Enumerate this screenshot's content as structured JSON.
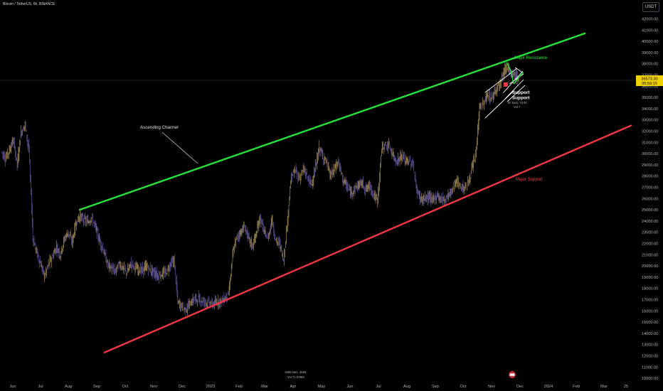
{
  "header": {
    "symbol_title": "Bitcoin / TetherUS, 6h, BINANCE",
    "currency": "USDT"
  },
  "chart_data": {
    "type": "line",
    "title": "Bitcoin / TetherUS, 6h, BINANCE",
    "ylim": [
      9500,
      42800
    ],
    "y_ticks": [
      "42000.00",
      "41000.00",
      "40000.00",
      "39000.00",
      "38000.00",
      "37000.00",
      "36000.00",
      "35000.00",
      "34000.00",
      "33000.00",
      "32000.00",
      "31000.00",
      "30000.00",
      "29000.00",
      "28000.00",
      "27000.00",
      "26000.00",
      "25000.00",
      "24000.00",
      "23000.00",
      "22000.00",
      "21000.00",
      "20000.00",
      "19000.00",
      "18000.00",
      "17000.00",
      "16000.00",
      "15000.00",
      "14000.00",
      "13000.00",
      "12000.00",
      "11000.00",
      "10000.00"
    ],
    "x_ticks": [
      "Jun",
      "Jul",
      "Aug",
      "Sep",
      "Oct",
      "Nov",
      "Dec",
      "2023",
      "Feb",
      "Mar",
      "Apr",
      "May",
      "Jun",
      "Jul",
      "Aug",
      "Sep",
      "Oct",
      "Nov",
      "Dec",
      "2024",
      "Feb",
      "Mar",
      "25"
    ],
    "current_price": "36573.30",
    "countdown": "05:59:15",
    "price_series": {
      "name": "",
      "values": [
        30200,
        29600,
        30300,
        31200,
        29000,
        31900,
        32600,
        30400,
        22500,
        21200,
        20100,
        19100,
        20200,
        20800,
        21700,
        21000,
        22400,
        23000,
        22100,
        23800,
        24500,
        24100,
        23900,
        24300,
        23400,
        22300,
        21400,
        20200,
        19800,
        19500,
        20200,
        19800,
        19400,
        20200,
        19900,
        19700,
        19600,
        20000,
        19600,
        19400,
        19100,
        19300,
        19400,
        20100,
        20500,
        16800,
        16400,
        16100,
        16600,
        17000,
        17100,
        16900,
        16800,
        16700,
        16600,
        16800,
        16900,
        17100,
        17600,
        21000,
        22500,
        23000,
        23500,
        22500,
        21800,
        22800,
        24300,
        23000,
        22400,
        24200,
        22200,
        22000,
        20500,
        24200,
        28000,
        28500,
        27800,
        28600,
        28000,
        27200,
        28400,
        30500,
        29800,
        29200,
        28000,
        28700,
        29300,
        27800,
        27200,
        26500,
        26800,
        27200,
        27400,
        26800,
        27200,
        26300,
        25800,
        30400,
        30800,
        30600,
        29800,
        29300,
        29800,
        29400,
        29300,
        29000,
        26700,
        26000,
        25900,
        26200,
        25800,
        26300,
        26000,
        25900,
        26300,
        26700,
        27600,
        27100,
        26900,
        27300,
        28500,
        29800,
        34200,
        34400,
        35200,
        34900,
        35600,
        36200,
        37100,
        37900,
        36900,
        37000,
        36573
      ]
    },
    "channel": {
      "resistance": {
        "label": "Major Resistance",
        "color": "#26e33b",
        "from": [
          38,
          25000
        ],
        "to": [
          226,
          40700
        ]
      },
      "support": {
        "label": "Major Support",
        "color": "#f23645",
        "from": [
          45,
          12300
        ],
        "to": [
          233,
          32500
        ]
      }
    },
    "annotations": {
      "channel_label": "Ascending Channel",
      "support_box_1": "Support",
      "support_box_2": "Support",
      "range_info": "60 bars, 7d 6h",
      "range_vol": "Vol 7",
      "bottom_info_1": "1866 bars, 466d",
      "bottom_info_2": "Vol 71.07BM"
    },
    "colors": {
      "background": "#000000",
      "candles_up": "#d3b36a",
      "candles_down": "#7f6bc9",
      "resistance": "#26e33b",
      "support": "#f23645",
      "price_label_bg": "#f0d000"
    }
  }
}
